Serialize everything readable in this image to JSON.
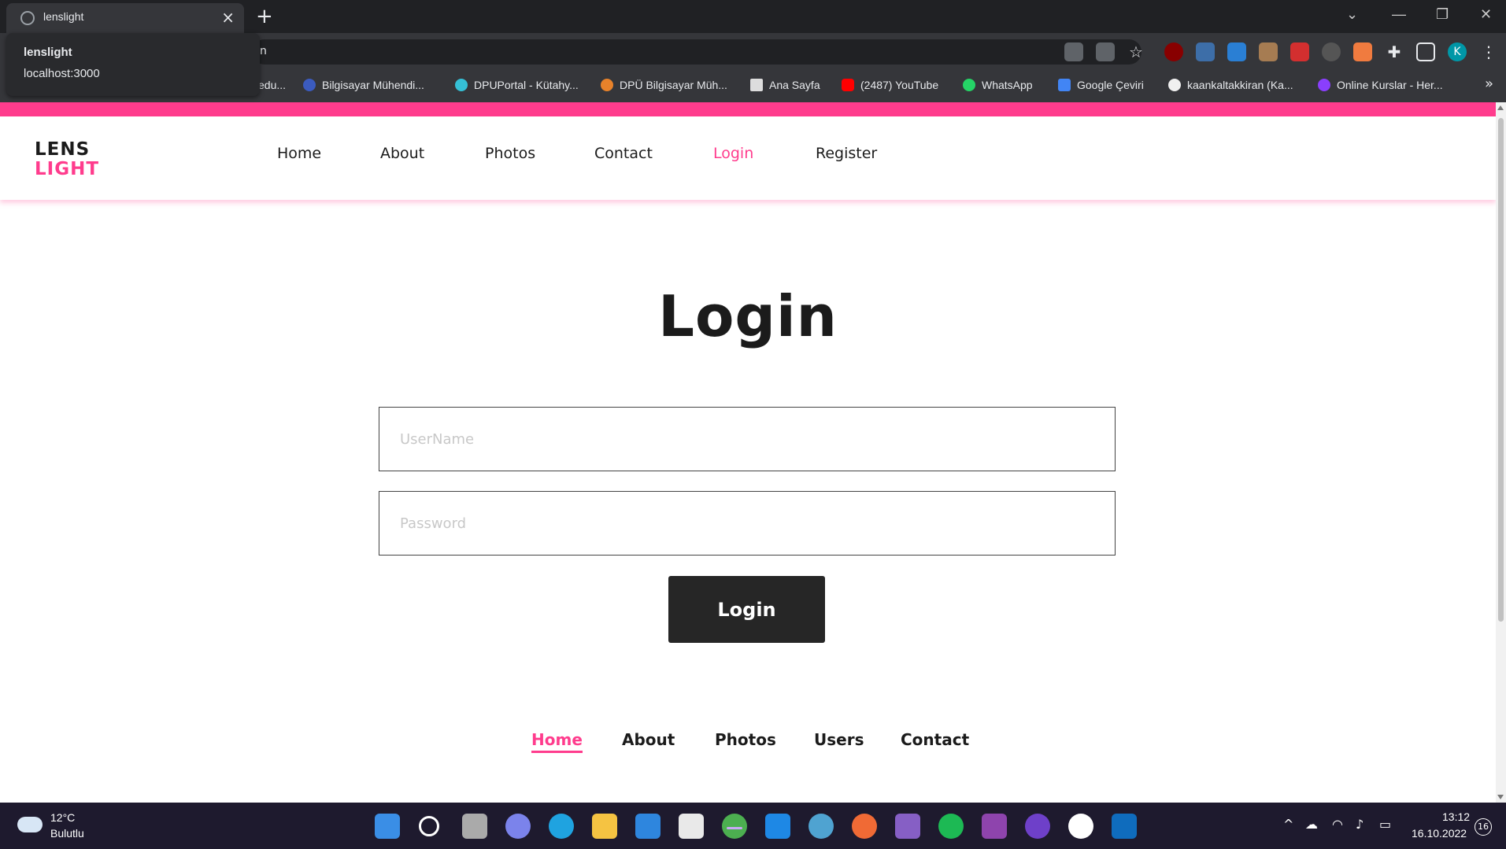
{
  "browser": {
    "tab_title": "lenslight",
    "hover_card": {
      "title": "lenslight",
      "url": "localhost:3000"
    },
    "omnibox_text": "n",
    "bookmarks": [
      "edu...",
      "Bilgisayar Mühendi...",
      "DPUPortal - Kütahy...",
      "DPÜ Bilgisayar Müh...",
      "Ana Sayfa",
      "(2487) YouTube",
      "WhatsApp",
      "Google Çeviri",
      "kaankaltakkiran (Ka...",
      "Online Kurslar - Her..."
    ],
    "profile_initial": "K"
  },
  "site": {
    "logo_line1": "LENS",
    "logo_line2": "LIGHT",
    "nav": [
      "Home",
      "About",
      "Photos",
      "Contact",
      "Login",
      "Register"
    ],
    "active_nav": "Login",
    "brand_color": "#ff3c8d"
  },
  "form": {
    "heading": "Login",
    "username_placeholder": "UserName",
    "password_placeholder": "Password",
    "submit_label": "Login"
  },
  "footer": {
    "links": [
      "Home",
      "About",
      "Photos",
      "Users",
      "Contact"
    ],
    "active": "Home"
  },
  "taskbar": {
    "temperature": "12°C",
    "weather": "Bulutlu",
    "time": "13:12",
    "date": "16.10.2022",
    "notifications": "16"
  }
}
